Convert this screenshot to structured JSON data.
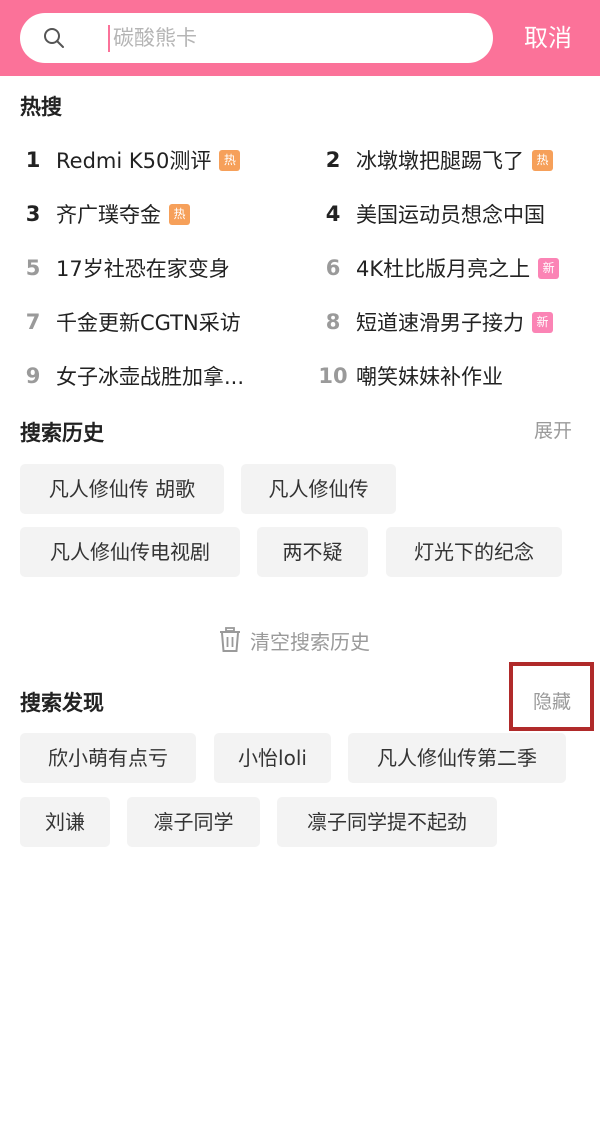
{
  "search": {
    "placeholder": "碳酸熊卡",
    "cancel_label": "取消"
  },
  "hot": {
    "title": "热搜",
    "items": [
      {
        "rank": "1",
        "title": "Redmi K50测评",
        "badge": "热"
      },
      {
        "rank": "2",
        "title": "冰墩墩把腿踢飞了",
        "badge": "热"
      },
      {
        "rank": "3",
        "title": "齐广璞夺金",
        "badge": "热"
      },
      {
        "rank": "4",
        "title": "美国运动员想念中国",
        "badge": ""
      },
      {
        "rank": "5",
        "title": "17岁社恐在家变身",
        "badge": ""
      },
      {
        "rank": "6",
        "title": "4K杜比版月亮之上",
        "badge": "新"
      },
      {
        "rank": "7",
        "title": "千金更新CGTN采访",
        "badge": ""
      },
      {
        "rank": "8",
        "title": "短道速滑男子接力",
        "badge": "新"
      },
      {
        "rank": "9",
        "title": "女子冰壶战胜加拿...",
        "badge": ""
      },
      {
        "rank": "10",
        "title": "嘲笑妹妹补作业",
        "badge": ""
      }
    ]
  },
  "history": {
    "title": "搜索历史",
    "expand_label": "展开",
    "tags": [
      "凡人修仙传 胡歌",
      "凡人修仙传",
      "凡人修仙传电视剧",
      "两不疑",
      "灯光下的纪念"
    ],
    "clear_label": "清空搜索历史"
  },
  "discover": {
    "title": "搜索发现",
    "hide_label": "隐藏",
    "tags": [
      "欣小萌有点亏",
      "小怡loli",
      "凡人修仙传第二季",
      "刘谦",
      "凛子同学",
      "凛子同学提不起劲"
    ]
  },
  "colors": {
    "brand": "#fb7299",
    "hot_badge": "#f6a05a",
    "new_badge": "#fb84b5",
    "highlight": "#b02a2a"
  }
}
